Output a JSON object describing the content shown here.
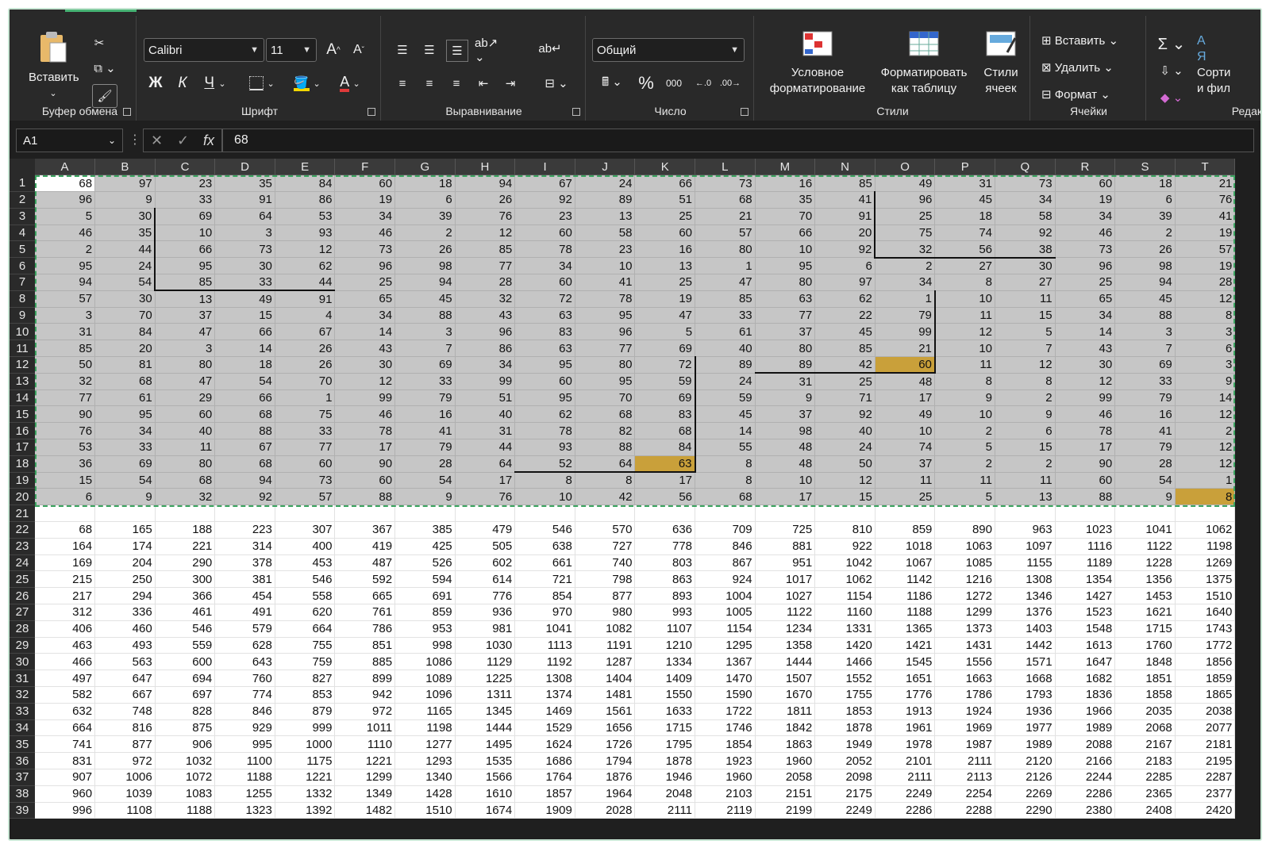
{
  "ribbon": {
    "clipboard": {
      "paste_label": "Вставить",
      "group_label": "Буфер обмена"
    },
    "font": {
      "font_name": "Calibri",
      "font_size": "11",
      "bold": "Ж",
      "italic": "К",
      "underline": "Ч",
      "grow": "A",
      "shrink": "A",
      "group_label": "Шрифт"
    },
    "alignment": {
      "group_label": "Выравнивание"
    },
    "number": {
      "format": "Общий",
      "percent": "%",
      "thousands": "000",
      "group_label": "Число"
    },
    "styles": {
      "conditional": "Условное форматирование",
      "as_table": "Форматировать как таблицу",
      "cell_styles": "Стили ячеек",
      "group_label": "Стили"
    },
    "cells": {
      "insert": "Вставить",
      "delete": "Удалить",
      "format": "Формат",
      "group_label": "Ячейки"
    },
    "editing": {
      "sort": "Сорти и фил",
      "group_label": "Редак"
    }
  },
  "formula_bar": {
    "name_box": "A1",
    "formula": "68",
    "fx": "fx"
  },
  "columns": [
    "A",
    "B",
    "C",
    "D",
    "E",
    "F",
    "G",
    "H",
    "I",
    "J",
    "K",
    "L",
    "M",
    "N",
    "O",
    "P",
    "Q",
    "R",
    "S",
    "T"
  ],
  "rows": [
    [
      68,
      97,
      23,
      35,
      84,
      60,
      18,
      94,
      67,
      24,
      66,
      73,
      16,
      85,
      49,
      31,
      73,
      60,
      18,
      21
    ],
    [
      96,
      9,
      33,
      91,
      86,
      19,
      6,
      26,
      92,
      89,
      51,
      68,
      35,
      41,
      96,
      45,
      34,
      19,
      6,
      76
    ],
    [
      5,
      30,
      69,
      64,
      53,
      34,
      39,
      76,
      23,
      13,
      25,
      21,
      70,
      91,
      25,
      18,
      58,
      34,
      39,
      41
    ],
    [
      46,
      35,
      10,
      3,
      93,
      46,
      2,
      12,
      60,
      58,
      60,
      57,
      66,
      20,
      75,
      74,
      92,
      46,
      2,
      19
    ],
    [
      2,
      44,
      66,
      73,
      12,
      73,
      26,
      85,
      78,
      23,
      16,
      80,
      10,
      92,
      32,
      56,
      38,
      73,
      26,
      57
    ],
    [
      95,
      24,
      95,
      30,
      62,
      96,
      98,
      77,
      34,
      10,
      13,
      1,
      95,
      6,
      2,
      27,
      30,
      96,
      98,
      19
    ],
    [
      94,
      54,
      85,
      33,
      44,
      25,
      94,
      28,
      60,
      41,
      25,
      47,
      80,
      97,
      34,
      8,
      27,
      25,
      94,
      28
    ],
    [
      57,
      30,
      13,
      49,
      91,
      65,
      45,
      32,
      72,
      78,
      19,
      85,
      63,
      62,
      1,
      10,
      11,
      65,
      45,
      12
    ],
    [
      3,
      70,
      37,
      15,
      4,
      34,
      88,
      43,
      63,
      95,
      47,
      33,
      77,
      22,
      79,
      11,
      15,
      34,
      88,
      8
    ],
    [
      31,
      84,
      47,
      66,
      67,
      14,
      3,
      96,
      83,
      96,
      5,
      61,
      37,
      45,
      99,
      12,
      5,
      14,
      3,
      3
    ],
    [
      85,
      20,
      3,
      14,
      26,
      43,
      7,
      86,
      63,
      77,
      69,
      40,
      80,
      85,
      21,
      10,
      7,
      43,
      7,
      6
    ],
    [
      50,
      81,
      80,
      18,
      26,
      30,
      69,
      34,
      95,
      80,
      72,
      89,
      89,
      42,
      60,
      11,
      12,
      30,
      69,
      3
    ],
    [
      32,
      68,
      47,
      54,
      70,
      12,
      33,
      99,
      60,
      95,
      59,
      24,
      31,
      25,
      48,
      8,
      8,
      12,
      33,
      9
    ],
    [
      77,
      61,
      29,
      66,
      1,
      99,
      79,
      51,
      95,
      70,
      69,
      59,
      9,
      71,
      17,
      9,
      2,
      99,
      79,
      14
    ],
    [
      90,
      95,
      60,
      68,
      75,
      46,
      16,
      40,
      62,
      68,
      83,
      45,
      37,
      92,
      49,
      10,
      9,
      46,
      16,
      12
    ],
    [
      76,
      34,
      40,
      88,
      33,
      78,
      41,
      31,
      78,
      82,
      68,
      14,
      98,
      40,
      10,
      2,
      6,
      78,
      41,
      2
    ],
    [
      53,
      33,
      11,
      67,
      77,
      17,
      79,
      44,
      93,
      88,
      84,
      55,
      48,
      24,
      74,
      5,
      15,
      17,
      79,
      12
    ],
    [
      36,
      69,
      80,
      68,
      60,
      90,
      28,
      64,
      52,
      64,
      63,
      8,
      48,
      50,
      37,
      2,
      2,
      90,
      28,
      12
    ],
    [
      15,
      54,
      68,
      94,
      73,
      60,
      54,
      17,
      8,
      8,
      17,
      8,
      10,
      12,
      11,
      11,
      11,
      60,
      54,
      1
    ],
    [
      6,
      9,
      32,
      92,
      57,
      88,
      9,
      76,
      10,
      42,
      56,
      68,
      17,
      15,
      25,
      5,
      13,
      88,
      9,
      8
    ],
    [],
    [
      68,
      165,
      188,
      223,
      307,
      367,
      385,
      479,
      546,
      570,
      636,
      709,
      725,
      810,
      859,
      890,
      963,
      1023,
      1041,
      1062
    ],
    [
      164,
      174,
      221,
      314,
      400,
      419,
      425,
      505,
      638,
      727,
      778,
      846,
      881,
      922,
      1018,
      1063,
      1097,
      1116,
      1122,
      1198
    ],
    [
      169,
      204,
      290,
      378,
      453,
      487,
      526,
      602,
      661,
      740,
      803,
      867,
      951,
      1042,
      1067,
      1085,
      1155,
      1189,
      1228,
      1269
    ],
    [
      215,
      250,
      300,
      381,
      546,
      592,
      594,
      614,
      721,
      798,
      863,
      924,
      1017,
      1062,
      1142,
      1216,
      1308,
      1354,
      1356,
      1375
    ],
    [
      217,
      294,
      366,
      454,
      558,
      665,
      691,
      776,
      854,
      877,
      893,
      1004,
      1027,
      1154,
      1186,
      1272,
      1346,
      1427,
      1453,
      1510
    ],
    [
      312,
      336,
      461,
      491,
      620,
      761,
      859,
      936,
      970,
      980,
      993,
      1005,
      1122,
      1160,
      1188,
      1299,
      1376,
      1523,
      1621,
      1640
    ],
    [
      406,
      460,
      546,
      579,
      664,
      786,
      953,
      981,
      1041,
      1082,
      1107,
      1154,
      1234,
      1331,
      1365,
      1373,
      1403,
      1548,
      1715,
      1743
    ],
    [
      463,
      493,
      559,
      628,
      755,
      851,
      998,
      1030,
      1113,
      1191,
      1210,
      1295,
      1358,
      1420,
      1421,
      1431,
      1442,
      1613,
      1760,
      1772
    ],
    [
      466,
      563,
      600,
      643,
      759,
      885,
      1086,
      1129,
      1192,
      1287,
      1334,
      1367,
      1444,
      1466,
      1545,
      1556,
      1571,
      1647,
      1848,
      1856
    ],
    [
      497,
      647,
      694,
      760,
      827,
      899,
      1089,
      1225,
      1308,
      1404,
      1409,
      1470,
      1507,
      1552,
      1651,
      1663,
      1668,
      1682,
      1851,
      1859
    ],
    [
      582,
      667,
      697,
      774,
      853,
      942,
      1096,
      1311,
      1374,
      1481,
      1550,
      1590,
      1670,
      1755,
      1776,
      1786,
      1793,
      1836,
      1858,
      1865
    ],
    [
      632,
      748,
      828,
      846,
      879,
      972,
      1165,
      1345,
      1469,
      1561,
      1633,
      1722,
      1811,
      1853,
      1913,
      1924,
      1936,
      1966,
      2035,
      2038
    ],
    [
      664,
      816,
      875,
      929,
      999,
      1011,
      1198,
      1444,
      1529,
      1656,
      1715,
      1746,
      1842,
      1878,
      1961,
      1969,
      1977,
      1989,
      2068,
      2077
    ],
    [
      741,
      877,
      906,
      995,
      1000,
      1110,
      1277,
      1495,
      1624,
      1726,
      1795,
      1854,
      1863,
      1949,
      1978,
      1987,
      1989,
      2088,
      2167,
      2181
    ],
    [
      831,
      972,
      1032,
      1100,
      1175,
      1221,
      1293,
      1535,
      1686,
      1794,
      1878,
      1923,
      1960,
      2052,
      2101,
      2111,
      2120,
      2166,
      2183,
      2195
    ],
    [
      907,
      1006,
      1072,
      1188,
      1221,
      1299,
      1340,
      1566,
      1764,
      1876,
      1946,
      1960,
      2058,
      2098,
      2111,
      2113,
      2126,
      2244,
      2285,
      2287
    ],
    [
      960,
      1039,
      1083,
      1255,
      1332,
      1349,
      1428,
      1610,
      1857,
      1964,
      2048,
      2103,
      2151,
      2175,
      2249,
      2254,
      2269,
      2286,
      2365,
      2377
    ],
    [
      996,
      1108,
      1188,
      1323,
      1392,
      1482,
      1510,
      1674,
      1909,
      2028,
      2111,
      2119,
      2199,
      2249,
      2286,
      2288,
      2290,
      2380,
      2408,
      2420
    ]
  ]
}
